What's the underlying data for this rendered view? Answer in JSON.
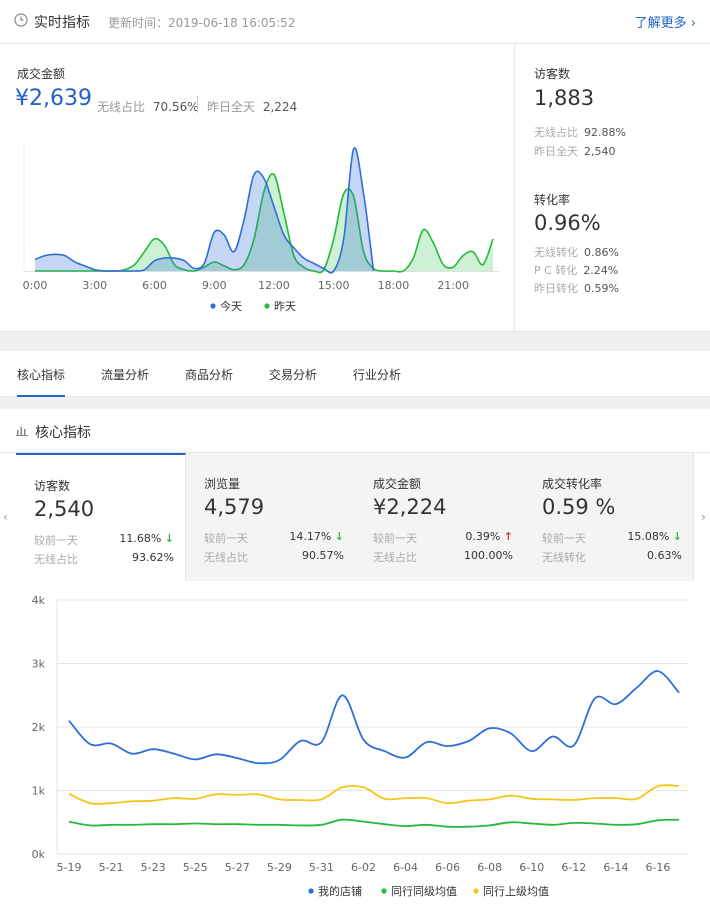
{
  "header": {
    "title": "实时指标",
    "update_time": "更新时间：2019-06-18 16:05:52",
    "more_link": "了解更多 ›"
  },
  "realtime": {
    "sales": {
      "label": "成交金额",
      "value": "¥2,639",
      "wireless_label": "无线占比",
      "wireless_value": "70.56%",
      "yesterday_label": "昨日全天",
      "yesterday_value": "2,224"
    },
    "visitors": {
      "label": "访客数",
      "value": "1,883",
      "wireless_label": "无线占比",
      "wireless_value": "92.88%",
      "yesterday_label": "昨日全天",
      "yesterday_value": "2,540"
    },
    "conversion": {
      "label": "转化率",
      "value": "0.96%",
      "wireless_label": "无线转化",
      "wireless_value": "0.86%",
      "pc_label": "P C 转化",
      "pc_value": "2.24%",
      "yesterday_label": "昨日转化",
      "yesterday_value": "0.59%"
    }
  },
  "tabs": [
    {
      "label": "核心指标",
      "active": true
    },
    {
      "label": "流量分析",
      "active": false
    },
    {
      "label": "商品分析",
      "active": false
    },
    {
      "label": "交易分析",
      "active": false
    },
    {
      "label": "行业分析",
      "active": false
    }
  ],
  "core": {
    "title": "核心指标",
    "cards": [
      {
        "label": "访客数",
        "value": "2,540",
        "cmp_label": "较前一天",
        "cmp_value": "11.68%",
        "trend": "down",
        "sub_label": "无线占比",
        "sub_value": "93.62%"
      },
      {
        "label": "浏览量",
        "value": "4,579",
        "cmp_label": "较前一天",
        "cmp_value": "14.17%",
        "trend": "down",
        "sub_label": "无线占比",
        "sub_value": "90.57%"
      },
      {
        "label": "成交金额",
        "value": "¥2,224",
        "cmp_label": "较前一天",
        "cmp_value": "0.39%",
        "trend": "up",
        "sub_label": "无线占比",
        "sub_value": "100.00%"
      },
      {
        "label": "成交转化率",
        "value": "0.59 %",
        "cmp_label": "较前一天",
        "cmp_value": "15.08%",
        "trend": "down",
        "sub_label": "无线转化",
        "sub_value": "0.63%"
      }
    ],
    "arrow_left": "‹",
    "arrow_right": "›"
  },
  "colors": {
    "accent": "#2462c4",
    "today": "#2f6fd6",
    "yesterday": "#22bb3a",
    "peer_top": "#f5c518"
  },
  "chart_data": [
    {
      "type": "area",
      "x_ticks": [
        "0:00",
        "3:00",
        "6:00",
        "9:00",
        "12:00",
        "15:00",
        "18:00",
        "21:00"
      ],
      "x": [
        0,
        0.5,
        1,
        1.5,
        2,
        2.5,
        3,
        3.5,
        4,
        4.5,
        5,
        5.5,
        6,
        6.5,
        7,
        7.5,
        8,
        8.5,
        9,
        9.5,
        10,
        10.5,
        11,
        11.5,
        12,
        12.5,
        13,
        13.5,
        14,
        14.5,
        15,
        15.5,
        16,
        16.5,
        17,
        17.5,
        18,
        18.5,
        19,
        19.5,
        20,
        20.5,
        21,
        21.5,
        22,
        22.5,
        23
      ],
      "series": [
        {
          "name": "今天",
          "values": [
            9,
            12,
            13,
            12,
            7,
            4,
            1,
            0,
            0,
            0,
            0,
            1,
            8,
            10,
            10,
            8,
            2,
            6,
            30,
            28,
            15,
            40,
            75,
            72,
            50,
            28,
            18,
            10,
            6,
            2,
            0,
            25,
            95,
            60,
            0
          ]
        },
        {
          "name": "昨天",
          "values": [
            0,
            0,
            0,
            0,
            0,
            0,
            0,
            0,
            0,
            1,
            5,
            15,
            25,
            20,
            5,
            1,
            0,
            3,
            7,
            4,
            1,
            5,
            25,
            62,
            75,
            45,
            12,
            3,
            0,
            1,
            25,
            60,
            58,
            15,
            2,
            0,
            0,
            0,
            10,
            32,
            22,
            5,
            3,
            12,
            15,
            5,
            25
          ]
        }
      ],
      "ylim": [
        0,
        105
      ],
      "legend": "bottom"
    },
    {
      "type": "line",
      "categories": [
        "5-19",
        "5-20",
        "5-21",
        "5-22",
        "5-23",
        "5-24",
        "5-25",
        "5-26",
        "5-27",
        "5-28",
        "5-29",
        "5-30",
        "5-31",
        "6-01",
        "6-02",
        "6-03",
        "6-04",
        "6-05",
        "6-06",
        "6-07",
        "6-08",
        "6-09",
        "6-10",
        "6-11",
        "6-12",
        "6-13",
        "6-14",
        "6-15",
        "6-16",
        "6-17"
      ],
      "x_ticks": [
        "5-19",
        "5-21",
        "5-23",
        "5-25",
        "5-27",
        "5-29",
        "5-31",
        "6-02",
        "6-04",
        "6-06",
        "6-08",
        "6-10",
        "6-12",
        "6-14",
        "6-16"
      ],
      "y_ticks": [
        "0k",
        "1k",
        "2k",
        "3k",
        "4k"
      ],
      "ylim": [
        0,
        4000
      ],
      "series": [
        {
          "name": "我的店铺",
          "values": [
            2100,
            1730,
            1740,
            1580,
            1650,
            1580,
            1490,
            1570,
            1510,
            1430,
            1480,
            1780,
            1760,
            2500,
            1800,
            1620,
            1520,
            1760,
            1700,
            1780,
            1980,
            1900,
            1620,
            1850,
            1710,
            2450,
            2360,
            2620,
            2880,
            2540
          ]
        },
        {
          "name": "同行同级均值",
          "values": [
            510,
            450,
            460,
            460,
            470,
            470,
            480,
            470,
            470,
            460,
            460,
            450,
            460,
            540,
            510,
            470,
            440,
            460,
            430,
            430,
            450,
            500,
            480,
            460,
            490,
            480,
            460,
            470,
            530,
            540
          ]
        },
        {
          "name": "同行上级均值",
          "values": [
            950,
            800,
            800,
            830,
            840,
            880,
            870,
            940,
            930,
            940,
            860,
            850,
            860,
            1050,
            1050,
            870,
            880,
            880,
            800,
            840,
            860,
            920,
            870,
            860,
            850,
            880,
            880,
            870,
            1070,
            1070
          ]
        }
      ],
      "legend": "bottom"
    }
  ]
}
